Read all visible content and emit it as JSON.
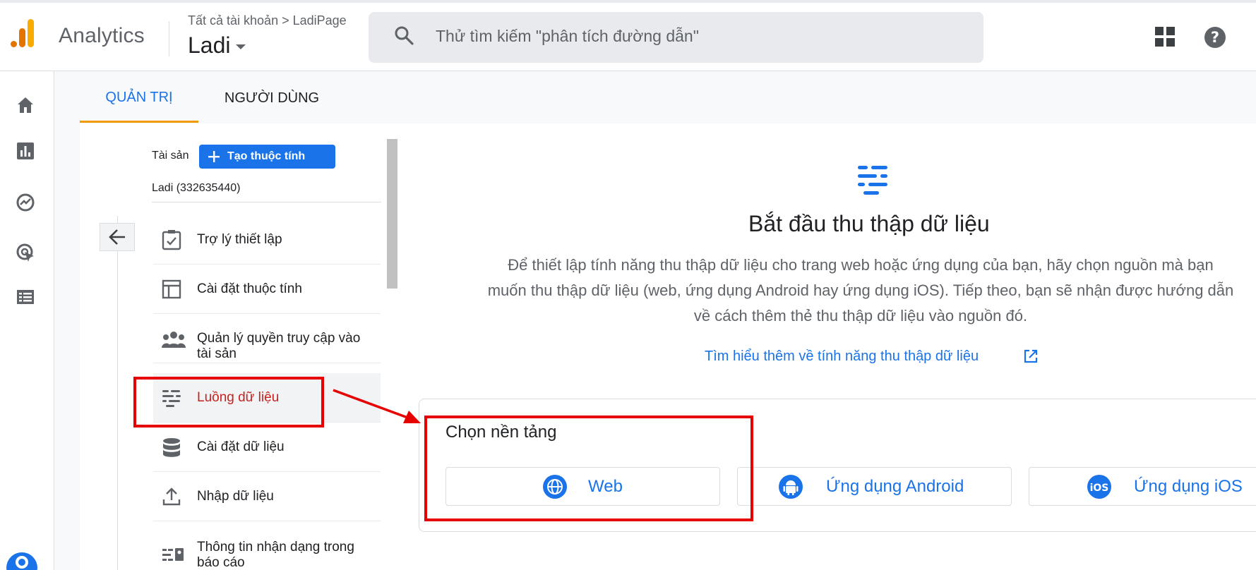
{
  "header": {
    "app_title": "Analytics",
    "breadcrumb": "Tất cả tài khoản > LadiPage",
    "account_name": "Ladi",
    "search_placeholder": "Thử tìm kiếm \"phân tích đường dẫn\""
  },
  "left_rail": {
    "items": [
      "home-icon",
      "reports-icon",
      "explore-icon",
      "advertising-icon",
      "configure-icon"
    ],
    "settings": "gear-icon"
  },
  "tabs": [
    {
      "label": "QUẢN TRỊ",
      "active": true
    },
    {
      "label": "NGƯỜI DÙNG",
      "active": false
    }
  ],
  "property": {
    "label": "Tài sản",
    "create_button": "Tạo thuộc tính",
    "name": "Ladi (332635440)"
  },
  "nav_items": [
    {
      "label": "Trợ lý thiết lập",
      "icon": "checklist-icon"
    },
    {
      "label": "Cài đặt thuộc tính",
      "icon": "layout-icon"
    },
    {
      "label": "Quản lý quyền truy cập vào tài sản",
      "icon": "people-icon"
    },
    {
      "label": "Luồng dữ liệu",
      "icon": "data-streams-icon",
      "active": true
    },
    {
      "label": "Cài đặt dữ liệu",
      "icon": "database-icon"
    },
    {
      "label": "Nhập dữ liệu",
      "icon": "upload-icon"
    },
    {
      "label": "Thông tin nhận dạng trong báo cáo",
      "icon": "reporting-identity-icon"
    }
  ],
  "main": {
    "title": "Bắt đầu thu thập dữ liệu",
    "description_lines": [
      "Để thiết lập tính năng thu thập dữ liệu cho trang web hoặc ứng dụng của bạn, hãy chọn nguồn mà bạn",
      "muốn thu thập dữ liệu (web, ứng dụng Android hay ứng dụng iOS). Tiếp theo, bạn sẽ nhận được hướng dẫn",
      "về cách thêm thẻ thu thập dữ liệu vào nguồn đó."
    ],
    "learn_more": "Tìm hiểu thêm về tính năng thu thập dữ liệu",
    "platform_title": "Chọn nền tảng",
    "platforms": [
      {
        "label": "Web",
        "icon": "globe-icon"
      },
      {
        "label": "Ứng dụng Android",
        "icon": "android-icon"
      },
      {
        "label": "Ứng dụng iOS",
        "icon": "ios-icon"
      }
    ]
  },
  "colors": {
    "accent": "#1a73e8",
    "tab_indicator": "#f29900",
    "active_nav_text": "#c5221f",
    "annotation_red": "#e60000"
  }
}
